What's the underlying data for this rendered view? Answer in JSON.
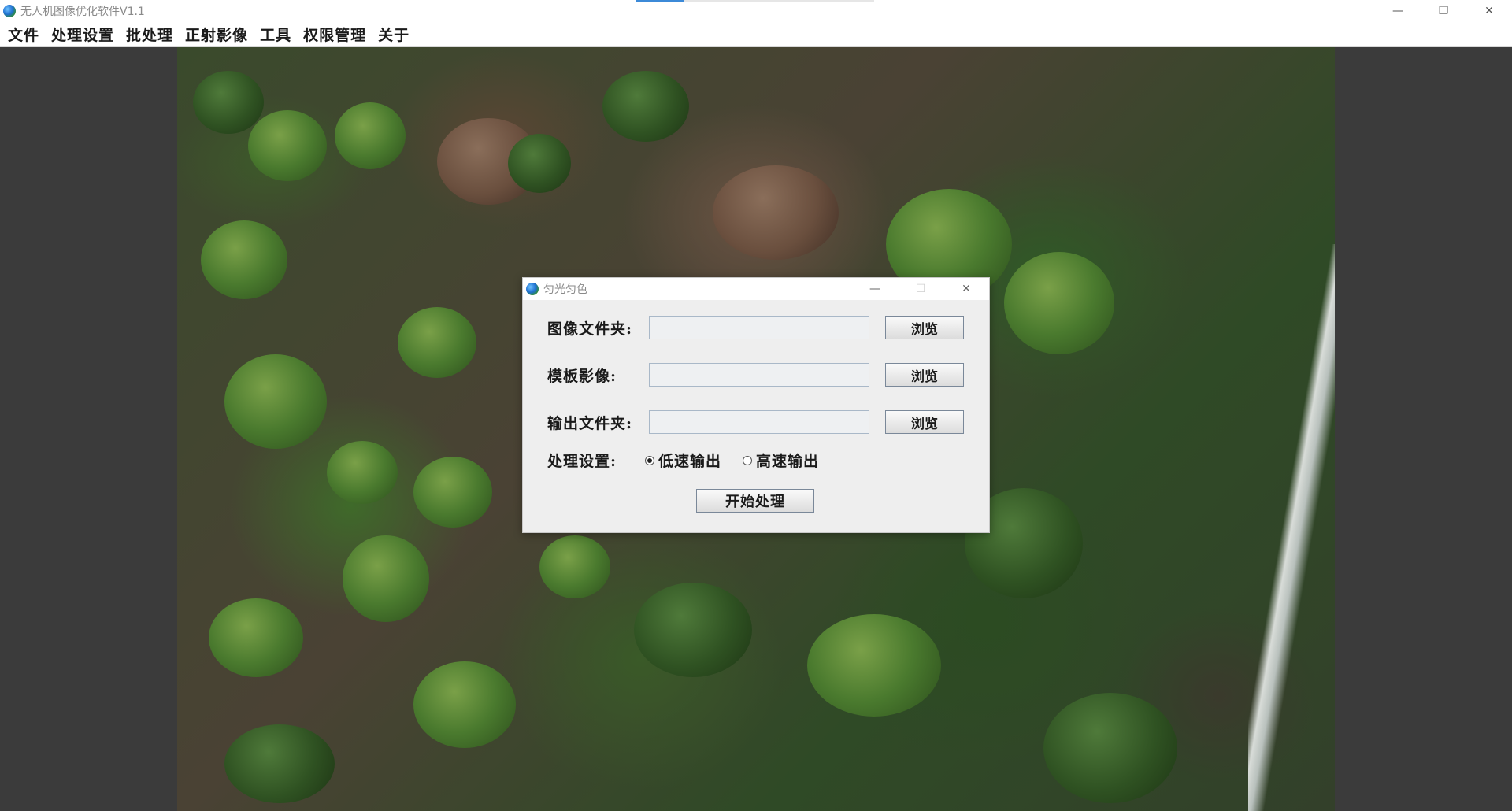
{
  "window": {
    "title": "无人机图像优化软件V1.1",
    "progress": 0.2,
    "minimize_glyph": "—",
    "restore_glyph": "❐",
    "close_glyph": "✕"
  },
  "menu": {
    "items": [
      "文件",
      "处理设置",
      "批处理",
      "正射影像",
      "工具",
      "权限管理",
      "关于"
    ]
  },
  "dialog": {
    "title": "匀光匀色",
    "minimize_glyph": "—",
    "maximize_glyph": "☐",
    "close_glyph": "✕",
    "image_folder": {
      "label": "图像文件夹:",
      "value": "",
      "browse_label": "浏览"
    },
    "template_image": {
      "label": "模板影像:",
      "value": "",
      "browse_label": "浏览"
    },
    "output_folder": {
      "label": "输出文件夹:",
      "value": "",
      "browse_label": "浏览"
    },
    "processing": {
      "label": "处理设置:",
      "options": [
        "低速输出",
        "高速输出"
      ],
      "selected": "低速输出"
    },
    "start_label": "开始处理"
  },
  "icons": {
    "app": "globe-icon",
    "dialog": "globe-icon"
  },
  "colors": {
    "workspace_bg": "#3b3b3b",
    "progress_accent": "#3c8ad8"
  }
}
